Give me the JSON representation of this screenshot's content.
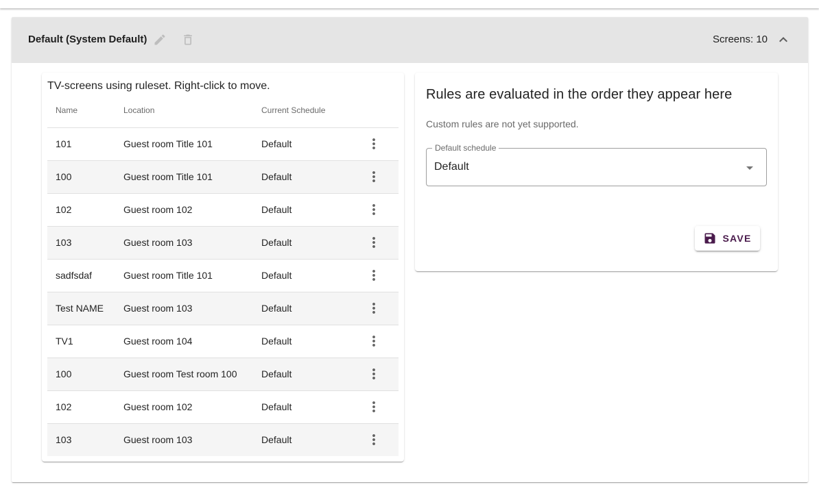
{
  "ruleset": {
    "title": "Default (System Default)",
    "screens_count_text": "Screens: 10"
  },
  "screens_table": {
    "caption": "TV-screens using ruleset. Right-click to move.",
    "columns": [
      "Name",
      "Location",
      "Current Schedule"
    ],
    "rows": [
      {
        "name": "101",
        "location": "Guest room Title 101",
        "schedule": "Default"
      },
      {
        "name": "100",
        "location": "Guest room Title 101",
        "schedule": "Default"
      },
      {
        "name": "102",
        "location": "Guest room 102",
        "schedule": "Default"
      },
      {
        "name": "103",
        "location": "Guest room 103",
        "schedule": "Default"
      },
      {
        "name": "sadfsdaf",
        "location": "Guest room Title 101",
        "schedule": "Default"
      },
      {
        "name": "Test NAME",
        "location": "Guest room 103",
        "schedule": "Default"
      },
      {
        "name": "TV1",
        "location": "Guest room 104",
        "schedule": "Default"
      },
      {
        "name": "100",
        "location": "Guest room Test room 100",
        "schedule": "Default"
      },
      {
        "name": "102",
        "location": "Guest room 102",
        "schedule": "Default"
      },
      {
        "name": "103",
        "location": "Guest room 103",
        "schedule": "Default"
      }
    ]
  },
  "rules": {
    "title": "Rules are evaluated in the order they appear here",
    "note": "Custom rules are not yet supported.",
    "default_schedule_label": "Default schedule",
    "default_schedule_value": "Default",
    "save_label": "SAVE"
  },
  "icons": {
    "edit": "pencil-icon",
    "delete": "trash-icon",
    "collapse": "chevron-up-icon",
    "row_menu": "more-vert-icon",
    "dropdown": "caret-down-icon",
    "save": "floppy-disk-icon"
  },
  "colors": {
    "header_bg": "#e5e5e5",
    "accent": "#4a1b4c",
    "disabled_icon": "#bdbdbd"
  }
}
